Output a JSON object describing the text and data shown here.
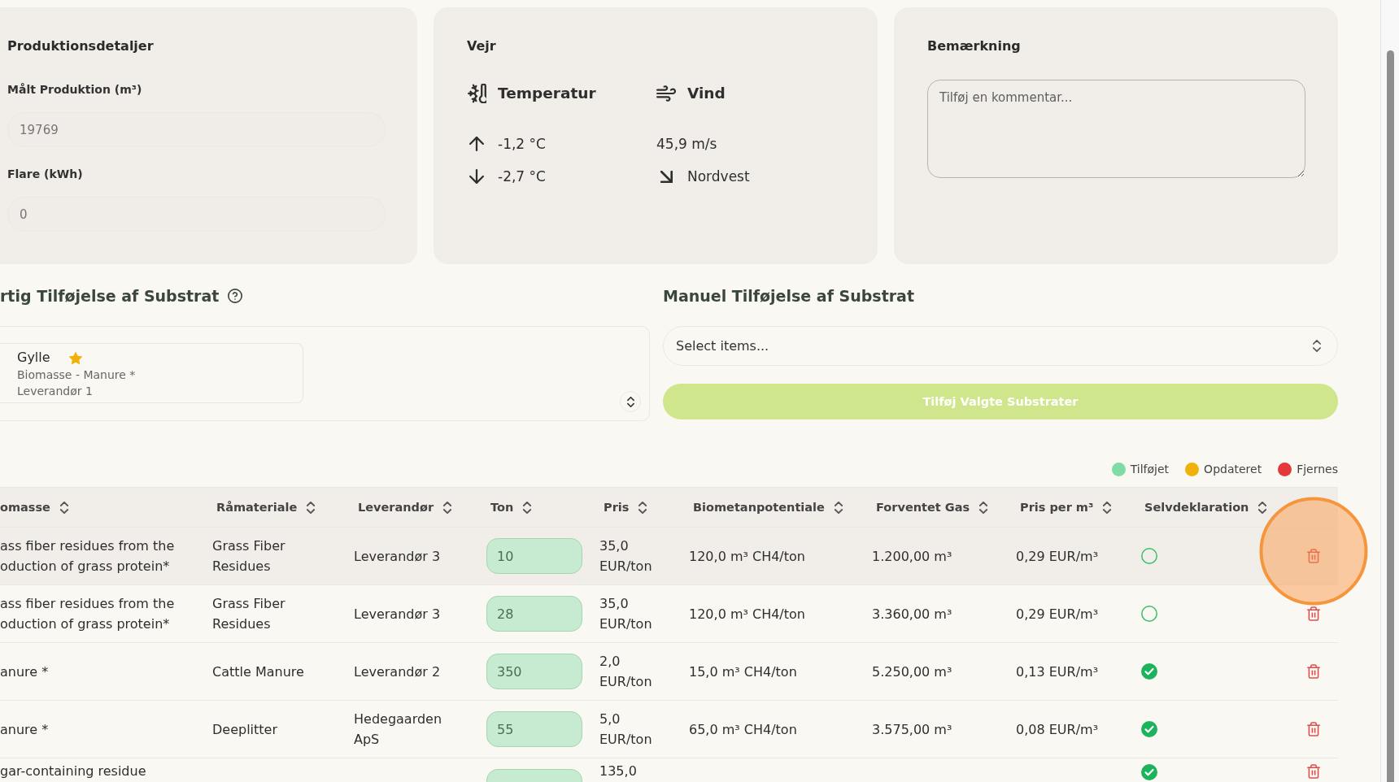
{
  "production": {
    "title": "Produktionsdetaljer",
    "fields": [
      {
        "label": "Målt Produktion (m³)",
        "value": "19769"
      },
      {
        "label": "Flare (kWh)",
        "value": "0"
      }
    ]
  },
  "weather": {
    "title": "Vejr",
    "temperature": {
      "label": "Temperatur",
      "high": "-1,2 °C",
      "low": "-2,7 °C"
    },
    "wind": {
      "label": "Vind",
      "speed": "45,9 m/s",
      "direction": "Nordvest"
    }
  },
  "remark": {
    "title": "Bemærkning",
    "placeholder": "Tilføj en kommentar..."
  },
  "quick_add": {
    "title": "rtig Tilføjelse af Substrat",
    "items": [
      {
        "name": "Gylle",
        "favorite": true,
        "category": "Biomasse - Manure *",
        "supplier": "Leverandør 1"
      }
    ]
  },
  "manual_add": {
    "title": "Manuel Tilføjelse af Substrat",
    "select": {
      "placeholder": "Select items..."
    },
    "button": {
      "label": "Tilføj Valgte Substrater",
      "disabled": true
    }
  },
  "legend": [
    {
      "label": "Tilføjet",
      "color": "#7fdca4"
    },
    {
      "label": "Opdateret",
      "color": "#f0b10a"
    },
    {
      "label": "Fjernes",
      "color": "#e5383b"
    }
  ],
  "table": {
    "columns": [
      "omasse",
      "Råmateriale",
      "Leverandør",
      "Ton",
      "Pris",
      "Biometanpotentiale",
      "Forventet Gas",
      "Pris per m³",
      "Selvdeklaration"
    ],
    "rows": [
      {
        "hovered": true,
        "biomass": "ass fiber residues from the oduction of grass protein*",
        "raw_material": "Grass Fiber Residues",
        "supplier": "Leverandør 3",
        "ton": "10",
        "price": "35,0 EUR/ton",
        "potential": "120,0 m³ CH4/ton",
        "expected_gas": "1.200,00 m³",
        "price_per_m3": "0,29 EUR/m³",
        "self_declared": false
      },
      {
        "hovered": false,
        "biomass": "ass fiber residues from the oduction of grass protein*",
        "raw_material": "Grass Fiber Residues",
        "supplier": "Leverandør 3",
        "ton": "28",
        "price": "35,0 EUR/ton",
        "potential": "120,0 m³ CH4/ton",
        "expected_gas": "3.360,00 m³",
        "price_per_m3": "0,29 EUR/m³",
        "self_declared": false
      },
      {
        "hovered": false,
        "biomass": "anure *",
        "raw_material": "Cattle Manure",
        "supplier": "Leverandør 2",
        "ton": "350",
        "price": "2,0 EUR/ton",
        "potential": "15,0 m³ CH4/ton",
        "expected_gas": "5.250,00 m³",
        "price_per_m3": "0,13 EUR/m³",
        "self_declared": true
      },
      {
        "hovered": false,
        "biomass": "anure *",
        "raw_material": "Deeplitter",
        "supplier": "Hedegaarden ApS",
        "ton": "55",
        "price": "5,0 EUR/ton",
        "potential": "65,0 m³ CH4/ton",
        "expected_gas": "3.575,00 m³",
        "price_per_m3": "0,08 EUR/m³",
        "self_declared": true
      },
      {
        "hovered": false,
        "biomass": "gar-containing residue",
        "price": "135,0",
        "self_declared": true
      }
    ]
  }
}
